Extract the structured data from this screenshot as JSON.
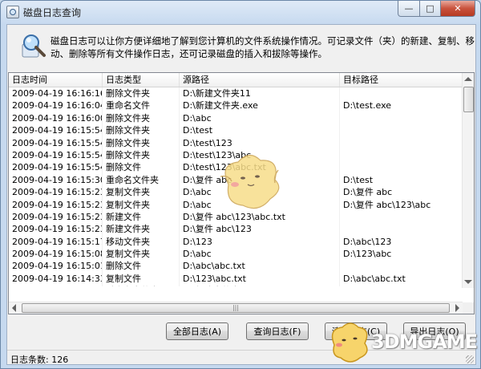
{
  "window": {
    "title": "磁盘日志查询",
    "controls": {
      "minimize": "—",
      "maximize": "□",
      "close": "✕"
    }
  },
  "description": {
    "line1": "磁盘日志可以让你方便详细地了解到您计算机的文件系统操作情况。可记录文件（夹）的新建、复制、移",
    "line2": "动、删除等所有文件操作日志，还可记录磁盘的插入和拔除等操作。"
  },
  "table": {
    "columns": [
      "日志时间",
      "日志类型",
      "源路径",
      "目标路径"
    ],
    "rows": [
      [
        "2009-04-19 16:16:16",
        "删除文件夹",
        "D:\\新建文件夹11",
        ""
      ],
      [
        "2009-04-19 16:16:04",
        "重命名文件",
        "D:\\新建文件夹.exe",
        "D:\\test.exe"
      ],
      [
        "2009-04-19 16:16:00",
        "删除文件夹",
        "D:\\abc",
        ""
      ],
      [
        "2009-04-19 16:15:54",
        "删除文件夹",
        "D:\\test",
        ""
      ],
      [
        "2009-04-19 16:15:54",
        "删除文件夹",
        "D:\\test\\123",
        ""
      ],
      [
        "2009-04-19 16:15:54",
        "删除文件夹",
        "D:\\test\\123\\abc",
        ""
      ],
      [
        "2009-04-19 16:15:54",
        "删除文件",
        "D:\\test\\123\\abc.txt",
        ""
      ],
      [
        "2009-04-19 16:15:30",
        "重命名文件夹",
        "D:\\复件 abc",
        "D:\\test"
      ],
      [
        "2009-04-19 16:15:23",
        "复制文件夹",
        "D:\\abc",
        "D:\\复件 abc"
      ],
      [
        "2009-04-19 16:15:23",
        "复制文件夹",
        "D:\\abc",
        "D:\\复件 abc\\123\\abc"
      ],
      [
        "2009-04-19 16:15:23",
        "新建文件",
        "D:\\复件 abc\\123\\abc.txt",
        ""
      ],
      [
        "2009-04-19 16:15:23",
        "新建文件夹",
        "D:\\复件 abc\\123",
        ""
      ],
      [
        "2009-04-19 16:15:17",
        "移动文件夹",
        "D:\\123",
        "D:\\abc\\123"
      ],
      [
        "2009-04-19 16:15:08",
        "复制文件夹",
        "D:\\abc",
        "D:\\123\\abc"
      ],
      [
        "2009-04-19 16:15:01",
        "删除文件",
        "D:\\abc\\abc.txt",
        ""
      ],
      [
        "2009-04-19 16:14:33",
        "复制文件",
        "D:\\123\\abc.txt",
        "D:\\abc\\abc.txt"
      ],
      [
        "2009-04-19 16:14:26",
        "重命名文件夹",
        "D:\\新建文件夹",
        "D:\\abc"
      ],
      [
        "2009-04-19 16:14:21",
        "新建文件夹",
        "D:\\新建文件夹",
        ""
      ]
    ]
  },
  "buttons": {
    "all_logs": "全部日志(A)",
    "query_logs": "查询日志(F)",
    "clear_logs": "清除日志(C)",
    "export_logs": "导出日志(O)"
  },
  "status": {
    "label": "日志条数:",
    "count": "126"
  },
  "watermark": {
    "text": "3DMGAME"
  }
}
